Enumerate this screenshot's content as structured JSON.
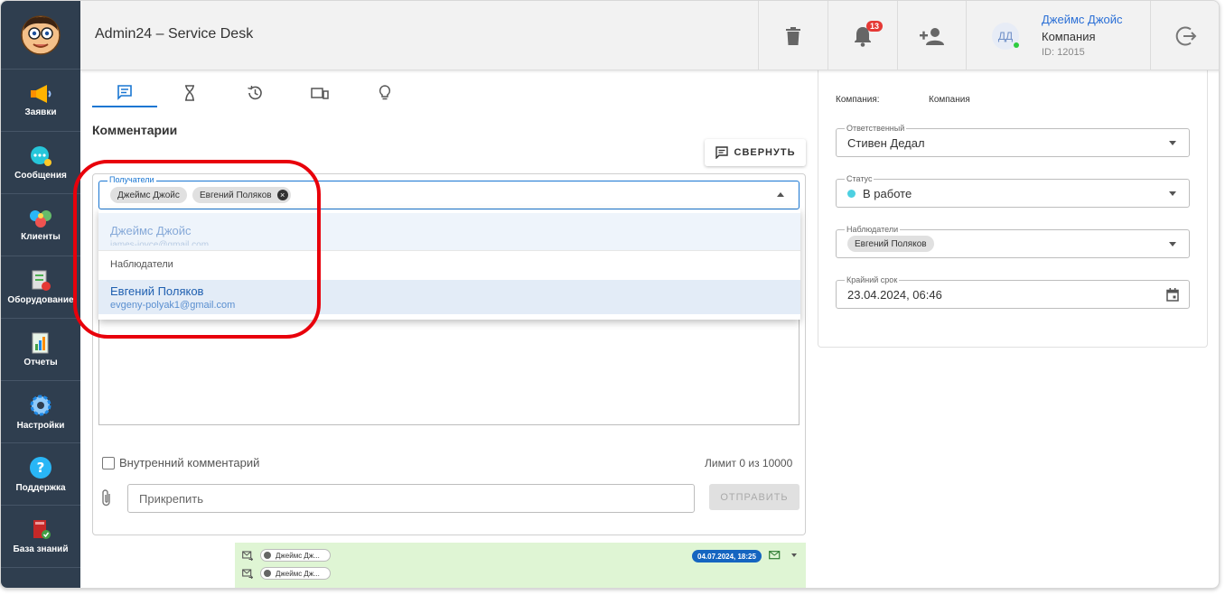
{
  "app": {
    "title": "Admin24 – Service Desk"
  },
  "sidebar": {
    "items": [
      {
        "label": "Заявки",
        "icon": "megaphone-icon"
      },
      {
        "label": "Сообщения",
        "icon": "chat-bubble-icon"
      },
      {
        "label": "Клиенты",
        "icon": "users-icon"
      },
      {
        "label": "Оборудование",
        "icon": "equipment-icon"
      },
      {
        "label": "Отчеты",
        "icon": "report-icon"
      },
      {
        "label": "Настройки",
        "icon": "gear-icon"
      },
      {
        "label": "Поддержка",
        "icon": "help-icon"
      },
      {
        "label": "База знаний",
        "icon": "knowledge-base-icon"
      }
    ]
  },
  "header": {
    "notifications_count": "13",
    "user": {
      "initials": "ДД",
      "name": "Джеймс Джойс",
      "company": "Компания",
      "id": "ID: 12015"
    }
  },
  "tabs": [
    {
      "icon": "comment-icon"
    },
    {
      "icon": "hourglass-icon"
    },
    {
      "icon": "history-icon"
    },
    {
      "icon": "devices-icon"
    },
    {
      "icon": "lightbulb-icon"
    }
  ],
  "comments": {
    "title": "Комментарии",
    "collapse_label": "СВЕРНУТЬ",
    "recipients": {
      "legend": "Получатели",
      "chips": [
        "Джеймс Джойс",
        "Евгений Поляков"
      ]
    },
    "dropdown": {
      "option1": {
        "name": "Джеймс Джойс",
        "email": "james-joyce@gmail.com"
      },
      "group_label": "Наблюдатели",
      "option2": {
        "name": "Евгений Поляков",
        "email": "evgeny-polyak1@gmail.com"
      }
    },
    "internal_label": "Внутренний комментарий",
    "limit": "Лимит 0 из 10000",
    "attach_placeholder": "Прикрепить",
    "send_label": "ОТПРАВИТЬ",
    "message": {
      "chip1": "Джеймс Дж...",
      "chip2": "Джеймс Дж...",
      "date": "04.07.2024, 18:25"
    }
  },
  "details": {
    "company_label": "Компания:",
    "company_value": "Компания",
    "assignee": {
      "legend": "Ответственный",
      "value": "Стивен Дедал"
    },
    "status": {
      "legend": "Статус",
      "value": "В работе",
      "color": "#4dd0e1"
    },
    "watchers": {
      "legend": "Наблюдатели",
      "chip": "Евгений Поляков"
    },
    "deadline": {
      "legend": "Крайний срок",
      "value": "23.04.2024, 06:46"
    }
  },
  "colors": {
    "sidebar": "#2f3e4f",
    "accent": "#1976d2",
    "highlight_ring": "#e8000b",
    "notification": "#e53935"
  }
}
